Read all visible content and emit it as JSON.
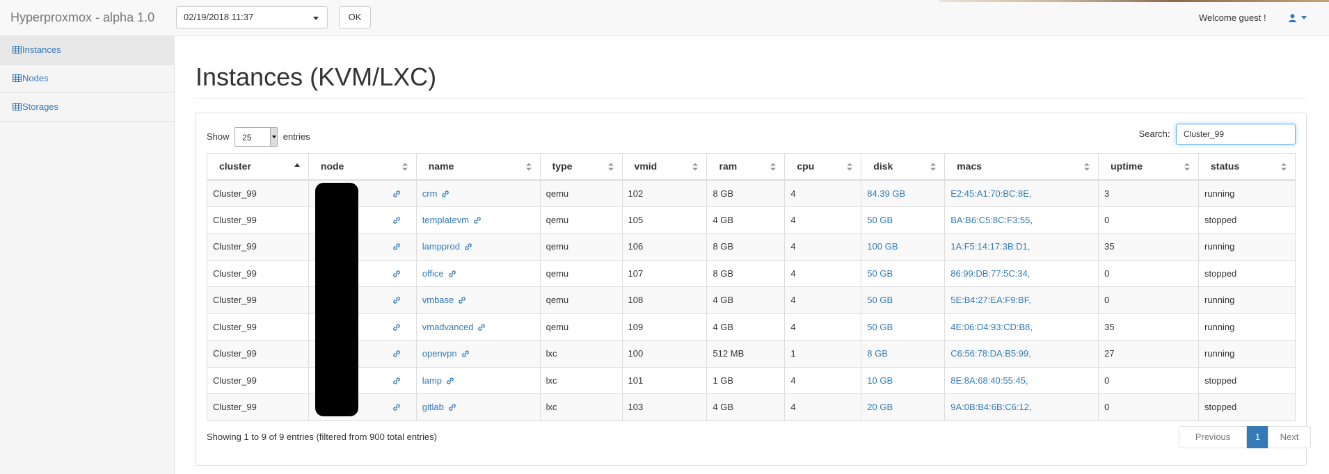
{
  "app": {
    "brand": "Hyperproxmox - alpha 1.0"
  },
  "header": {
    "date_value": "02/19/2018 11:37",
    "ok_label": "OK",
    "welcome": "Welcome guest !"
  },
  "sidebar": {
    "items": [
      {
        "label": "Instances",
        "icon": "table-icon",
        "active": true
      },
      {
        "label": "Nodes",
        "icon": "table-icon",
        "active": false
      },
      {
        "label": "Storages",
        "icon": "table-icon",
        "active": false
      }
    ]
  },
  "main": {
    "title": "Instances (KVM/LXC)",
    "show_label": "Show",
    "entries_value": "25",
    "entries_label": "entries",
    "search_label": "Search:",
    "search_value": "Cluster_99",
    "columns": [
      "cluster",
      "node",
      "name",
      "type",
      "vmid",
      "ram",
      "cpu",
      "disk",
      "macs",
      "uptime",
      "status"
    ],
    "rows": [
      {
        "cluster": "Cluster_99",
        "node": "",
        "name": "crm",
        "type": "qemu",
        "vmid": "102",
        "ram": "8 GB",
        "cpu": "4",
        "disk": "84.39 GB",
        "macs": "E2:45:A1:70:BC:8E,",
        "uptime": "3",
        "status": "running"
      },
      {
        "cluster": "Cluster_99",
        "node": "",
        "name": "templatevm",
        "type": "qemu",
        "vmid": "105",
        "ram": "4 GB",
        "cpu": "4",
        "disk": "50 GB",
        "macs": "BA:B6:C5:8C:F3:55,",
        "uptime": "0",
        "status": "stopped"
      },
      {
        "cluster": "Cluster_99",
        "node": "",
        "name": "lampprod",
        "type": "qemu",
        "vmid": "106",
        "ram": "8 GB",
        "cpu": "4",
        "disk": "100 GB",
        "macs": "1A:F5:14:17:3B:D1,",
        "uptime": "35",
        "status": "running"
      },
      {
        "cluster": "Cluster_99",
        "node": "",
        "name": "office",
        "type": "qemu",
        "vmid": "107",
        "ram": "8 GB",
        "cpu": "4",
        "disk": "50 GB",
        "macs": "86:99:DB:77:5C:34,",
        "uptime": "0",
        "status": "stopped"
      },
      {
        "cluster": "Cluster_99",
        "node": "",
        "name": "vmbase",
        "type": "qemu",
        "vmid": "108",
        "ram": "4 GB",
        "cpu": "4",
        "disk": "50 GB",
        "macs": "5E:B4:27:EA:F9:BF,",
        "uptime": "0",
        "status": "running"
      },
      {
        "cluster": "Cluster_99",
        "node": "",
        "name": "vmadvanced",
        "type": "qemu",
        "vmid": "109",
        "ram": "4 GB",
        "cpu": "4",
        "disk": "50 GB",
        "macs": "4E:06:D4:93:CD:B8,",
        "uptime": "35",
        "status": "running"
      },
      {
        "cluster": "Cluster_99",
        "node": "",
        "name": "openvpn",
        "type": "lxc",
        "vmid": "100",
        "ram": "512 MB",
        "cpu": "1",
        "disk": "8 GB",
        "macs": "C6:56:78:DA:B5:99,",
        "uptime": "27",
        "status": "running"
      },
      {
        "cluster": "Cluster_99",
        "node": "",
        "name": "lamp",
        "type": "lxc",
        "vmid": "101",
        "ram": "1 GB",
        "cpu": "4",
        "disk": "10 GB",
        "macs": "8E:8A:68:40:55:45,",
        "uptime": "0",
        "status": "stopped"
      },
      {
        "cluster": "Cluster_99",
        "node": "",
        "name": "gitlab",
        "type": "lxc",
        "vmid": "103",
        "ram": "4 GB",
        "cpu": "4",
        "disk": "20 GB",
        "macs": "9A:0B:B4:6B:C6:12,",
        "uptime": "0",
        "status": "stopped"
      }
    ],
    "info": "Showing 1 to 9 of 9 entries (filtered from 900 total entries)",
    "pagination": {
      "previous": "Previous",
      "current": "1",
      "next": "Next"
    }
  },
  "colors": {
    "link": "#337ab7",
    "navbar_bg": "#f8f8f8",
    "active_page": "#337ab7"
  }
}
